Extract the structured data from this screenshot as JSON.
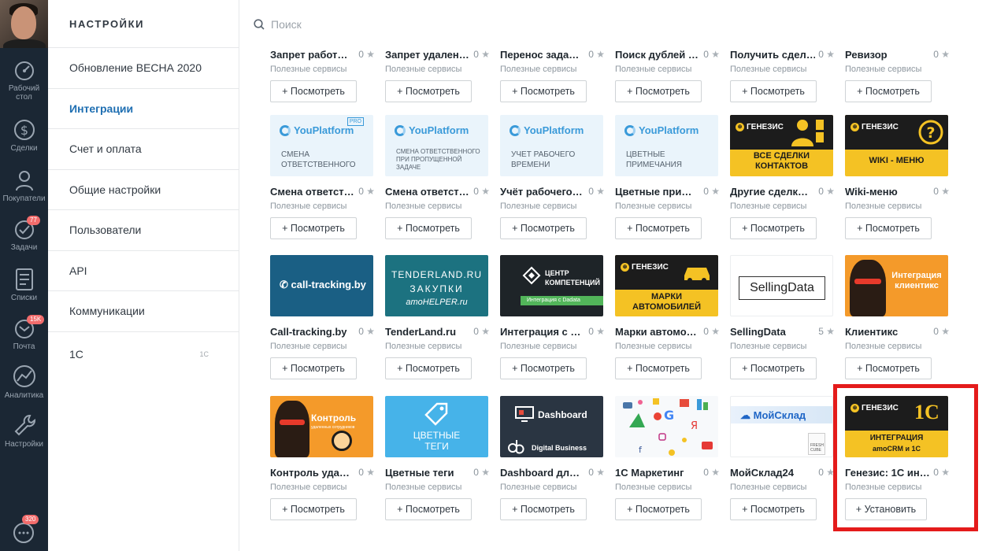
{
  "leftnav": {
    "items": [
      {
        "label1": "Рабочий",
        "label2": "стол",
        "icon": "dashboard-icon"
      },
      {
        "label1": "Сделки",
        "icon": "dollar-icon"
      },
      {
        "label1": "Покупатели",
        "icon": "buyers-icon"
      },
      {
        "label1": "Задачи",
        "icon": "check-icon",
        "badge": "77"
      },
      {
        "label1": "Списки",
        "icon": "list-icon"
      },
      {
        "label1": "Почта",
        "icon": "mail-icon",
        "badge": "15K"
      },
      {
        "label1": "Аналитика",
        "icon": "analytics-icon"
      },
      {
        "label1": "Настройки",
        "icon": "wrench-icon"
      }
    ],
    "chat_badge": "320"
  },
  "settings": {
    "title": "НАСТРОЙКИ",
    "items": [
      {
        "label": "Обновление ВЕСНА 2020"
      },
      {
        "label": "Интеграции"
      },
      {
        "label": "Счет и оплата"
      },
      {
        "label": "Общие настройки"
      },
      {
        "label": "Пользователи"
      },
      {
        "label": "API"
      },
      {
        "label": "Коммуникации"
      },
      {
        "label": "1С",
        "sub": "1С"
      }
    ]
  },
  "search": {
    "placeholder": "Поиск"
  },
  "cards": [
    {
      "name": "Запрет работ…",
      "rating": "0",
      "category": "Полезные сервисы",
      "button": "+ Посмотреть"
    },
    {
      "name": "Запрет удален…",
      "rating": "0",
      "category": "Полезные сервисы",
      "button": "+ Посмотреть"
    },
    {
      "name": "Перенос зада…",
      "rating": "0",
      "category": "Полезные сервисы",
      "button": "+ Посмотреть"
    },
    {
      "name": "Поиск дублей …",
      "rating": "0",
      "category": "Полезные сервисы",
      "button": "+ Посмотреть"
    },
    {
      "name": "Получить сдел…",
      "rating": "0",
      "category": "Полезные сервисы",
      "button": "+ Посмотреть"
    },
    {
      "name": "Ревизор",
      "rating": "0",
      "category": "Полезные сервисы",
      "button": "+ Посмотреть"
    },
    {
      "name": "Смена ответст…",
      "rating": "0",
      "category": "Полезные сервисы",
      "button": "+ Посмотреть",
      "thumb": {
        "brand": "YouPlatform",
        "text": "СМЕНА ОТВЕТСТВЕННОГО",
        "pro": "PRO"
      }
    },
    {
      "name": "Смена ответст…",
      "rating": "0",
      "category": "Полезные сервисы",
      "button": "+ Посмотреть",
      "thumb": {
        "brand": "YouPlatform",
        "text": "СМЕНА ОТВЕТСТВЕННОГО ПРИ ПРОПУЩЕННОЙ ЗАДАЧЕ"
      }
    },
    {
      "name": "Учёт рабочего…",
      "rating": "0",
      "category": "Полезные сервисы",
      "button": "+ Посмотреть",
      "thumb": {
        "brand": "YouPlatform",
        "text": "УЧЕТ РАБОЧЕГО ВРЕМЕНИ"
      }
    },
    {
      "name": "Цветные при…",
      "rating": "0",
      "category": "Полезные сервисы",
      "button": "+ Посмотреть",
      "thumb": {
        "brand": "YouPlatform",
        "text": "ЦВЕТНЫЕ ПРИМЕЧАНИЯ"
      }
    },
    {
      "name": "Другие сделк…",
      "rating": "0",
      "category": "Полезные сервисы",
      "button": "+ Посмотреть",
      "thumb": {
        "brand": "ГЕНЕЗИС",
        "text1": "ВСЕ СДЕЛКИ",
        "text2": "КОНТАКТОВ"
      }
    },
    {
      "name": "Wiki-меню",
      "rating": "0",
      "category": "Полезные сервисы",
      "button": "+ Посмотреть",
      "thumb": {
        "brand": "ГЕНЕЗИС",
        "text1": "WIKI - МЕНЮ"
      }
    },
    {
      "name": "Call-tracking.by",
      "rating": "0",
      "category": "Полезные сервисы",
      "button": "+ Посмотреть",
      "thumb": {
        "text": "call-tracking.by"
      }
    },
    {
      "name": "TenderLand.ru",
      "rating": "0",
      "category": "Полезные сервисы",
      "button": "+ Посмотреть",
      "thumb": {
        "text1": "TENDERLAND.RU",
        "text2": "ЗАКУПКИ",
        "text3": "amoHELPER.ru"
      }
    },
    {
      "name": "Интеграция с …",
      "rating": "0",
      "category": "Полезные сервисы",
      "button": "+ Посмотреть",
      "thumb": {
        "text1": "ЦЕНТР",
        "text2": "КОМПЕТЕНЦИЙ",
        "bar": "Интеграция с Dadata"
      }
    },
    {
      "name": "Марки автомо…",
      "rating": "0",
      "category": "Полезные сервисы",
      "button": "+ Посмотреть",
      "thumb": {
        "brand": "ГЕНЕЗИС",
        "text1": "МАРКИ",
        "text2": "АВТОМОБИЛЕЙ"
      }
    },
    {
      "name": "SellingData",
      "rating": "5",
      "category": "Полезные сервисы",
      "button": "+ Посмотреть",
      "thumb": {
        "text": "SellingData"
      }
    },
    {
      "name": "Клиентикс",
      "rating": "0",
      "category": "Полезные сервисы",
      "button": "+ Посмотреть",
      "thumb": {
        "text1": "Интеграция",
        "text2": "клиентикс"
      }
    },
    {
      "name": "Контроль уда…",
      "rating": "0",
      "category": "Полезные сервисы",
      "button": "+ Посмотреть",
      "thumb": {
        "text": "Контроль",
        "sub": "удаленных сотрудников"
      }
    },
    {
      "name": "Цветные теги",
      "rating": "0",
      "category": "Полезные сервисы",
      "button": "+ Посмотреть",
      "thumb": {
        "text1": "ЦВЕТНЫЕ",
        "text2": "ТЕГИ"
      }
    },
    {
      "name": "Dashboard дл…",
      "rating": "0",
      "category": "Полезные сервисы",
      "button": "+ Посмотреть",
      "thumb": {
        "text": "Dashboard",
        "bar": "Digital Business"
      }
    },
    {
      "name": "1С Маркетинг",
      "rating": "0",
      "category": "Полезные сервисы",
      "button": "+ Посмотреть"
    },
    {
      "name": "МойСклад24",
      "rating": "0",
      "category": "Полезные сервисы",
      "button": "+ Посмотреть",
      "thumb": {
        "text": "МойСклад",
        "cube": "FRESH CUBE"
      }
    },
    {
      "name": "Генезис: 1С ин…",
      "rating": "0",
      "category": "Полезные сервисы",
      "button": "+ Установить",
      "thumb": {
        "brand": "ГЕНЕЗИС",
        "mark": "1С",
        "text1": "ИНТЕГРАЦИЯ",
        "text2": "amoCRM и 1С"
      }
    }
  ],
  "colors": {
    "accent": "#1f6fb2",
    "nav_bg": "#1b2734",
    "highlight": "#e41b1b",
    "genesis_yellow": "#f4c224"
  }
}
